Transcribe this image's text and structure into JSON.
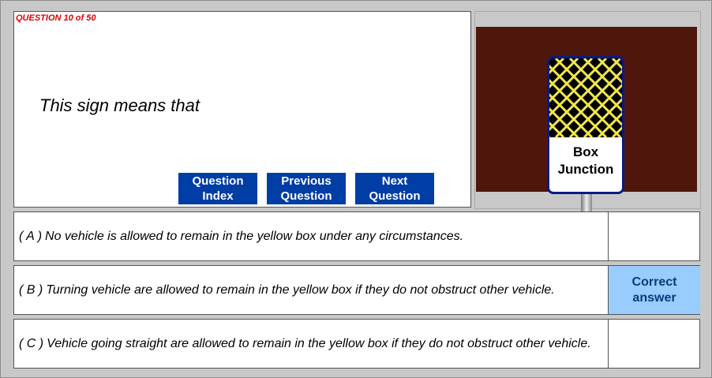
{
  "question": {
    "counter": "QUESTION 10 of 50",
    "text": "This sign means that"
  },
  "nav": {
    "index_label": "Question\nIndex",
    "previous_label": "Previous\nQuestion",
    "next_label": "Next\nQuestion"
  },
  "sign": {
    "label": "Box\nJunction",
    "colors": {
      "background": "#4f170b",
      "board_border": "#0a1a86",
      "grid": "#f2e64a"
    }
  },
  "answers": [
    {
      "letter": "( A )",
      "text": "No vehicle is allowed to remain in the yellow box under any circumstances.",
      "status": ""
    },
    {
      "letter": "( B )",
      "text": "Turning vehicle are allowed to remain in the yellow box if they do not obstruct other vehicle.",
      "status": "Correct\nanswer"
    },
    {
      "letter": "( C )",
      "text": "Vehicle going straight are allowed to remain in the yellow box if they do not obstruct other vehicle.",
      "status": ""
    }
  ],
  "colors": {
    "correct_highlight": "#99ccff",
    "nav_button": "#003da5",
    "counter": "#e00000"
  }
}
